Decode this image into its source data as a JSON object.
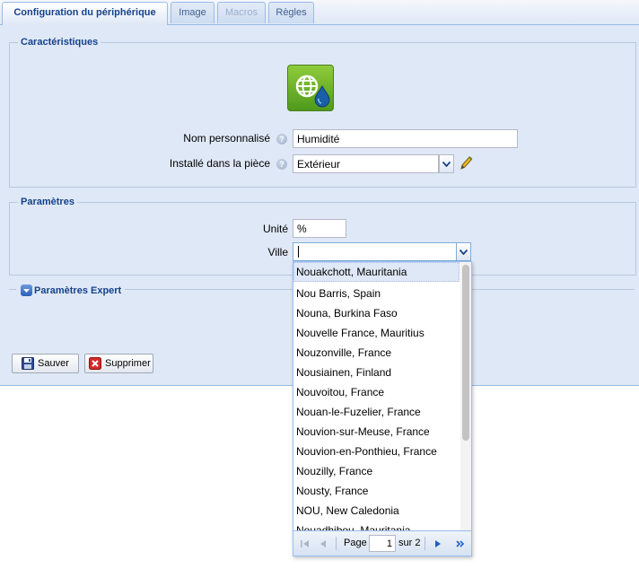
{
  "tabs": [
    {
      "label": "Configuration du périphérique"
    },
    {
      "label": "Image"
    },
    {
      "label": "Macros"
    },
    {
      "label": "Règles"
    }
  ],
  "characteristics": {
    "legend": "Caractéristiques",
    "name_label": "Nom personnalisé",
    "name_value": "Humidité",
    "room_label": "Installé dans la pièce",
    "room_value": "Extérieur"
  },
  "parameters": {
    "legend": "Paramètres",
    "unit_label": "Unité",
    "unit_value": "%",
    "city_label": "Ville",
    "city_value": ""
  },
  "expert": {
    "legend": "Paramètres Expert"
  },
  "buttons": {
    "save": "Sauver",
    "delete": "Supprimer"
  },
  "dropdown": {
    "items": [
      "Nouakchott, Mauritania",
      "Nou Barris, Spain",
      "Nouna, Burkina Faso",
      "Nouvelle France, Mauritius",
      "Nouzonville, France",
      "Nousiainen, Finland",
      "Nouvoitou, France",
      "Nouan-le-Fuzelier, France",
      "Nouvion-sur-Meuse, France",
      "Nouvion-en-Ponthieu, France",
      "Nouzilly, France",
      "Nousty, France",
      "NOU, New Caledonia",
      "Nouadhibou, Mauritania"
    ],
    "pager": {
      "page_label": "Page",
      "page_value": "1",
      "of_label": "sur 2"
    }
  },
  "colors": {
    "accent": "#15428b",
    "panel": "#dfe8f6",
    "border": "#99bbe8"
  },
  "icons": {
    "device": "globe-humidity-icon",
    "help": "help-icon",
    "edit": "pencil-icon",
    "save": "floppy-disk-icon",
    "delete": "red-x-icon"
  }
}
